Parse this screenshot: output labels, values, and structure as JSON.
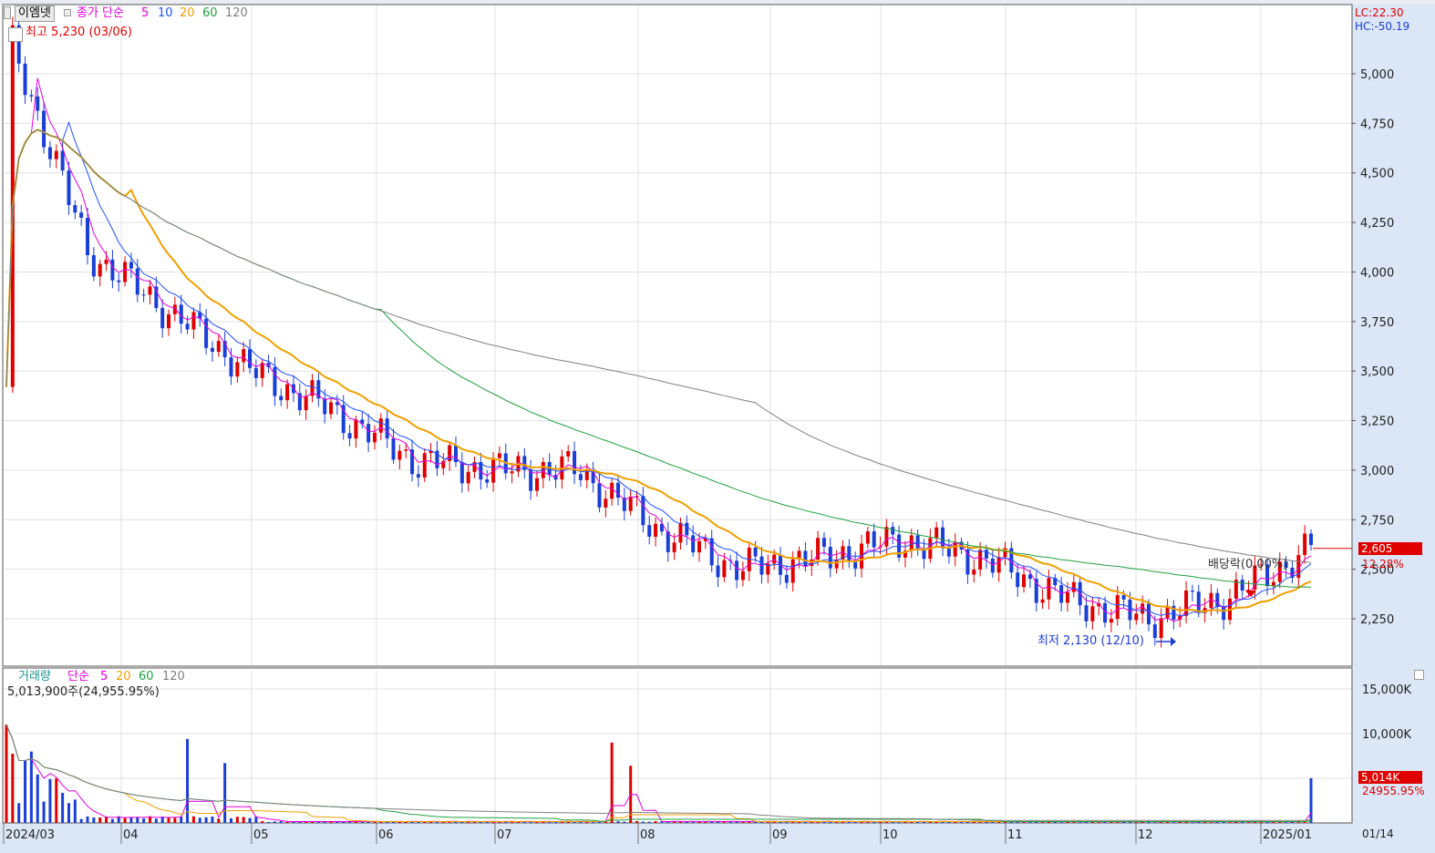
{
  "price_panel": {
    "stock_name": "이엠넷",
    "ma_type": "종가 단순",
    "ma_periods": [
      "5",
      "10",
      "20",
      "60",
      "120"
    ],
    "ma_colors": [
      "#e000e0",
      "#2050ff",
      "#f0a000",
      "#20a040",
      "#808080"
    ],
    "high_marker": "최고 5,230 (03/06)",
    "low_marker": "최저 2,130 (12/10)",
    "dividend_marker": "배당락(0.00%)",
    "lc": "LC:22.30",
    "hc": "HC:-50.19",
    "current_price": "2,605",
    "change_pct": "12.28%",
    "y_ticks": [
      "5,000",
      "4,750",
      "4,500",
      "4,250",
      "4,000",
      "3,750",
      "3,500",
      "3,250",
      "3,000",
      "2,750",
      "2,500",
      "2,250"
    ]
  },
  "volume_panel": {
    "title": "거래량",
    "ma_type": "단순",
    "ma_periods": [
      "5",
      "20",
      "60",
      "120"
    ],
    "ma_colors": [
      "#e000e0",
      "#f0a000",
      "#20a040",
      "#808080"
    ],
    "last_volume": "5,013,900주(24,955.95%)",
    "current_volume": "5,014K",
    "change_pct": "24955.95%",
    "y_ticks": [
      "15,000K",
      "10,000K"
    ]
  },
  "x_axis": {
    "labels": [
      "2024/03",
      "04",
      "05",
      "06",
      "07",
      "08",
      "09",
      "10",
      "11",
      "12",
      "2025/01"
    ],
    "right_label": "01/14"
  },
  "chart_data": [
    {
      "type": "line",
      "title": "",
      "x": [
        "2024/03",
        "04",
        "05",
        "06",
        "07",
        "08",
        "09",
        "10",
        "11",
        "12",
        "2025/01"
      ],
      "series": [
        {
          "name": "종가",
          "values": [
            3400,
            3750,
            3850,
            3250,
            3000,
            3000,
            2450,
            2600,
            2650,
            2300,
            2605
          ]
        },
        {
          "name": "5",
          "values": [
            4400,
            3800,
            3800,
            3300,
            3020,
            3050,
            2500,
            2580,
            2650,
            2300,
            2380
          ]
        },
        {
          "name": "10",
          "values": [
            4200,
            3800,
            3750,
            3350,
            3030,
            3100,
            2520,
            2570,
            2640,
            2330,
            2370
          ]
        },
        {
          "name": "20",
          "values": [
            3700,
            4000,
            3700,
            3350,
            3050,
            3000,
            2650,
            2570,
            2620,
            2450,
            2370
          ]
        },
        {
          "name": "60",
          "values": [
            3450,
            3650,
            3800,
            3750,
            3300,
            2950,
            2780,
            2720,
            2620,
            2520,
            2460
          ]
        },
        {
          "name": "120",
          "values": [
            3200,
            3300,
            3450,
            3600,
            3550,
            3500,
            3300,
            3080,
            2880,
            2700,
            2580
          ]
        }
      ],
      "ylim": [
        2130,
        5230
      ]
    },
    {
      "type": "bar",
      "title": "거래량",
      "x": [
        "2024/03",
        "04",
        "05",
        "06",
        "07",
        "08",
        "09",
        "10",
        "11",
        "12",
        "2025/01"
      ],
      "values": [
        12000,
        500,
        800,
        300,
        200,
        9000,
        200,
        200,
        150,
        100,
        5014
      ],
      "ylim": [
        0,
        16000
      ]
    }
  ]
}
